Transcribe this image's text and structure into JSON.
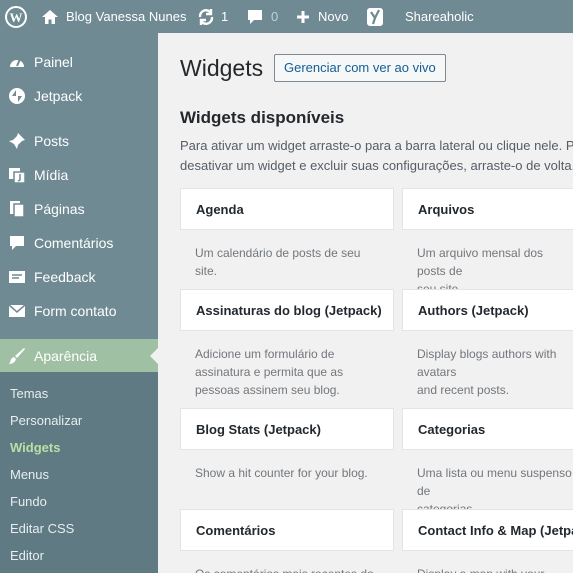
{
  "adminbar": {
    "site_name": "Blog Vanessa Nunes",
    "updates_count": "1",
    "comments_count": "0",
    "new_label": "Novo",
    "shareaholic_label": "Shareaholic"
  },
  "sidebar": {
    "items": [
      {
        "label": "Painel"
      },
      {
        "label": "Jetpack"
      },
      {
        "label": "Posts"
      },
      {
        "label": "Mídia"
      },
      {
        "label": "Páginas"
      },
      {
        "label": "Comentários"
      },
      {
        "label": "Feedback"
      },
      {
        "label": "Form contato"
      },
      {
        "label": "Aparência"
      }
    ],
    "submenu": [
      {
        "label": "Temas"
      },
      {
        "label": "Personalizar"
      },
      {
        "label": "Widgets"
      },
      {
        "label": "Menus"
      },
      {
        "label": "Fundo"
      },
      {
        "label": "Editar CSS"
      },
      {
        "label": "Editor"
      }
    ]
  },
  "main": {
    "title": "Widgets",
    "live_button": "Gerenciar com ver ao vivo",
    "section_title": "Widgets disponíveis",
    "description_line1": "Para ativar um widget arraste-o para a barra lateral ou clique nele. Para",
    "description_line2": "desativar um widget e excluir suas configurações, arraste-o de volta.",
    "widgets": [
      {
        "title": "Agenda",
        "desc": "Um calendário de posts de seu\nsite."
      },
      {
        "title": "Arquivos",
        "desc": "Um arquivo mensal dos posts de\nseu site"
      },
      {
        "title": "Assinaturas do blog (Jetpack)",
        "desc": "Adicione um formulário de\nassinatura e permita que as\npessoas assinem seu blog."
      },
      {
        "title": "Authors (Jetpack)",
        "desc": "Display blogs authors with avatars\nand recent posts."
      },
      {
        "title": "Blog Stats (Jetpack)",
        "desc": "Show a hit counter for your blog."
      },
      {
        "title": "Categorias",
        "desc": "Uma lista ou menu suspenso de\ncategorias."
      },
      {
        "title": "Comentários",
        "desc": "Os comentários mais recentes do"
      },
      {
        "title": "Contact Info & Map (Jetpack)",
        "desc": "Display a map with your location"
      }
    ]
  },
  "colors": {
    "sidebar_bg": "#6f8a93",
    "active_bg": "#9fc0a2",
    "current_submenu": "#b7e0a6",
    "link_blue": "#135e96"
  }
}
